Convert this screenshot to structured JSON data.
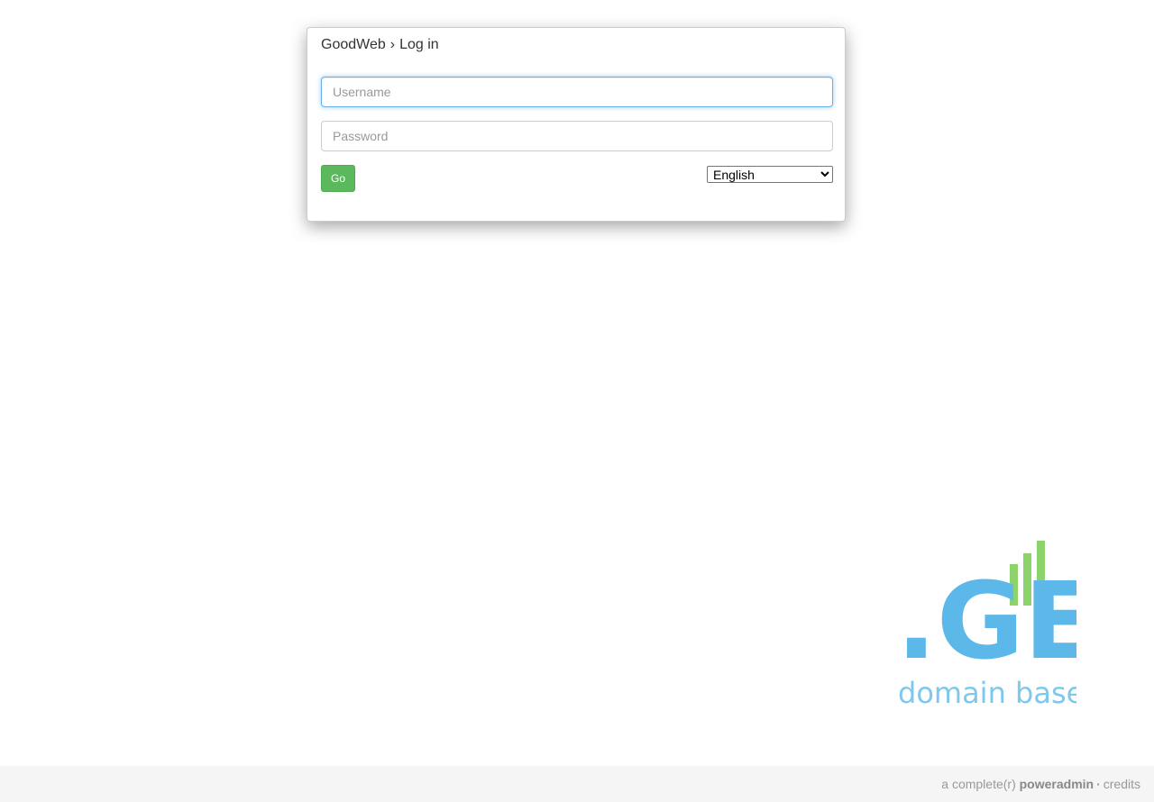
{
  "panel": {
    "breadcrumb_site": "GoodWeb",
    "breadcrumb_separator": "›",
    "breadcrumb_page": "Log in"
  },
  "form": {
    "username_placeholder": "Username",
    "username_value": "",
    "password_placeholder": "Password",
    "password_value": "",
    "go_label": "Go",
    "language_selected": "English"
  },
  "logo": {
    "mark": ".GE",
    "tagline": "domain base",
    "color_primary": "#5bb8e8",
    "color_accent": "#8cd36b",
    "icon": "bar-chart-icon"
  },
  "footer": {
    "prefix": "a complete(r)",
    "brand": "poweradmin",
    "separator": "·",
    "credits": "credits"
  },
  "colors": {
    "go_button": "#5cb85c",
    "focus_border": "#66afe9",
    "footer_bg": "#f5f5f5"
  }
}
